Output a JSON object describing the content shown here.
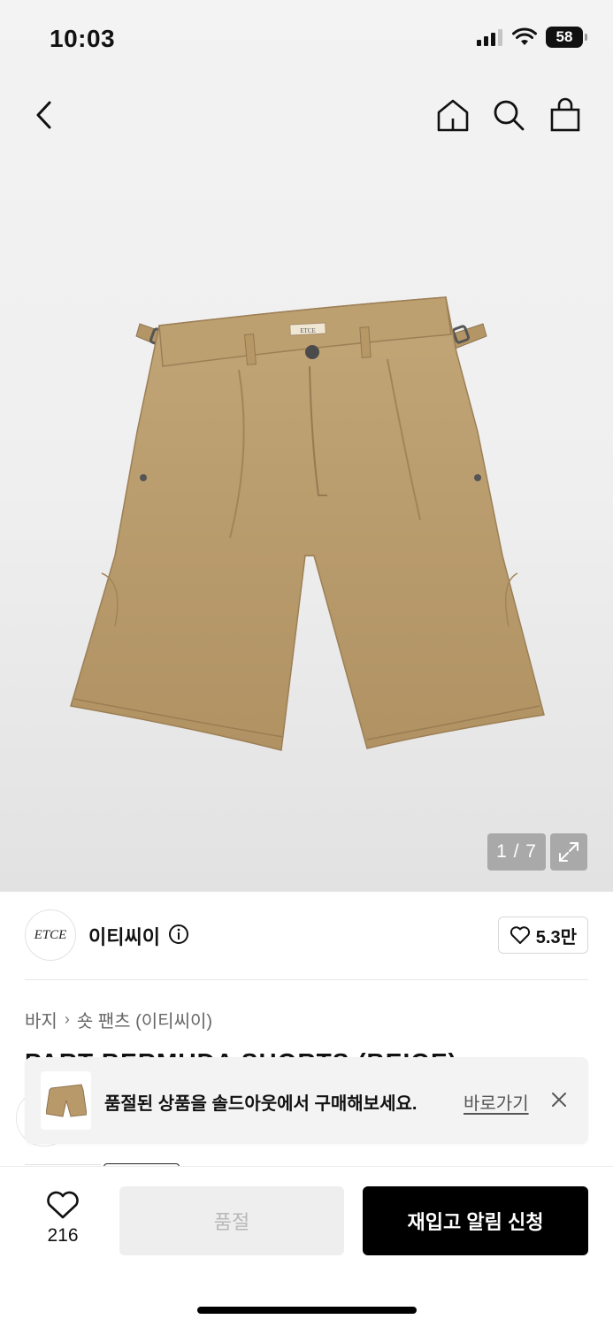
{
  "status_bar": {
    "time": "10:03",
    "battery": "58"
  },
  "gallery": {
    "counter": "1 / 7",
    "waistband_tag": "ETCE"
  },
  "brand": {
    "logo_text": "ETCE",
    "name": "이티씨이",
    "likes": "5.3만"
  },
  "breadcrumb": {
    "category": "바지",
    "subcategory": "숏 팬츠 (이티씨이)"
  },
  "product": {
    "title_peek": "PART BERMUDA SHORTS (BEIGE)"
  },
  "toast": {
    "message": "품절된 상품을 솔드아웃에서 구매해보세요.",
    "link_label": "바로가기"
  },
  "bottom_bar": {
    "wish_count": "216",
    "soldout_label": "품절",
    "restock_label": "재입고 알림 신청"
  },
  "colors": {
    "accent": "#000000",
    "disabled_bg": "#eeeeee",
    "product_khaki": "#b8996a"
  }
}
